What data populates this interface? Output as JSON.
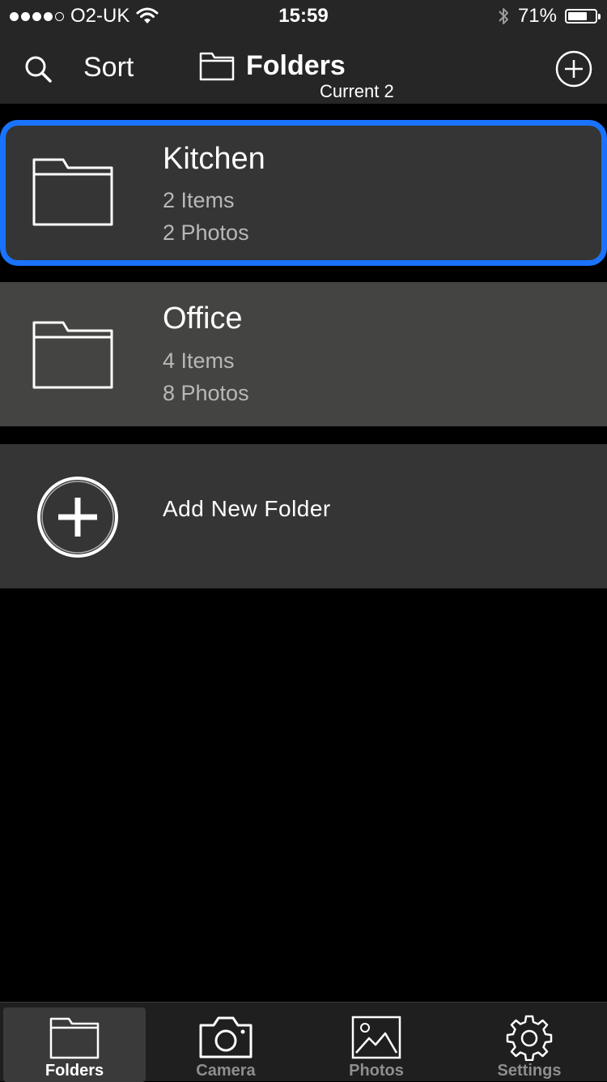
{
  "status_bar": {
    "carrier": "O2-UK",
    "time": "15:59",
    "battery_percent": "71%",
    "battery_level": 0.71,
    "signal_icon": "signal-dots",
    "wifi_icon": "wifi-icon",
    "bluetooth_icon": "bluetooth-icon"
  },
  "nav": {
    "sort_label": "Sort",
    "title": "Folders",
    "subtitle": "Current 2"
  },
  "folders": [
    {
      "name": "Kitchen",
      "items": "2 Items",
      "photos": "2 Photos",
      "selected": true
    },
    {
      "name": "Office",
      "items": "4 Items",
      "photos": "8 Photos",
      "selected": false
    }
  ],
  "add_new": {
    "label": "Add New Folder"
  },
  "tabs": [
    {
      "label": "Folders",
      "icon": "folder-icon",
      "active": true
    },
    {
      "label": "Camera",
      "icon": "camera-icon",
      "active": false
    },
    {
      "label": "Photos",
      "icon": "photo-icon",
      "active": false
    },
    {
      "label": "Settings",
      "icon": "gear-icon",
      "active": false
    }
  ],
  "colors": {
    "selection_border": "#1a73ff",
    "row_bg": "#353535",
    "row_bg_alt": "#444443",
    "bar_bg": "#262626"
  }
}
